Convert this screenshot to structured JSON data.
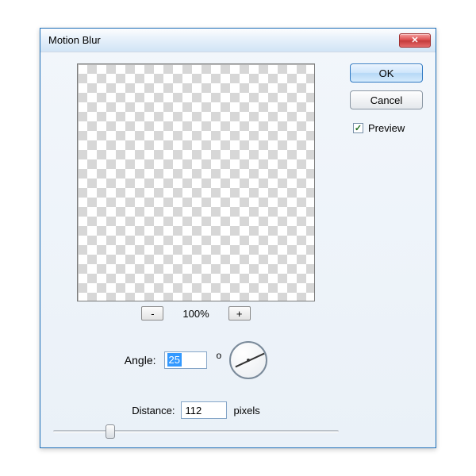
{
  "dialog": {
    "title": "Motion Blur",
    "close_icon": "✕"
  },
  "buttons": {
    "ok": "OK",
    "cancel": "Cancel"
  },
  "preview_toggle": {
    "label": "Preview",
    "checked_mark": "✓"
  },
  "zoom": {
    "out_label": "-",
    "in_label": "+",
    "level": "100%"
  },
  "angle": {
    "label": "Angle:",
    "value": "25",
    "unit": "o"
  },
  "distance": {
    "label": "Distance:",
    "value": "112",
    "unit": "pixels"
  }
}
